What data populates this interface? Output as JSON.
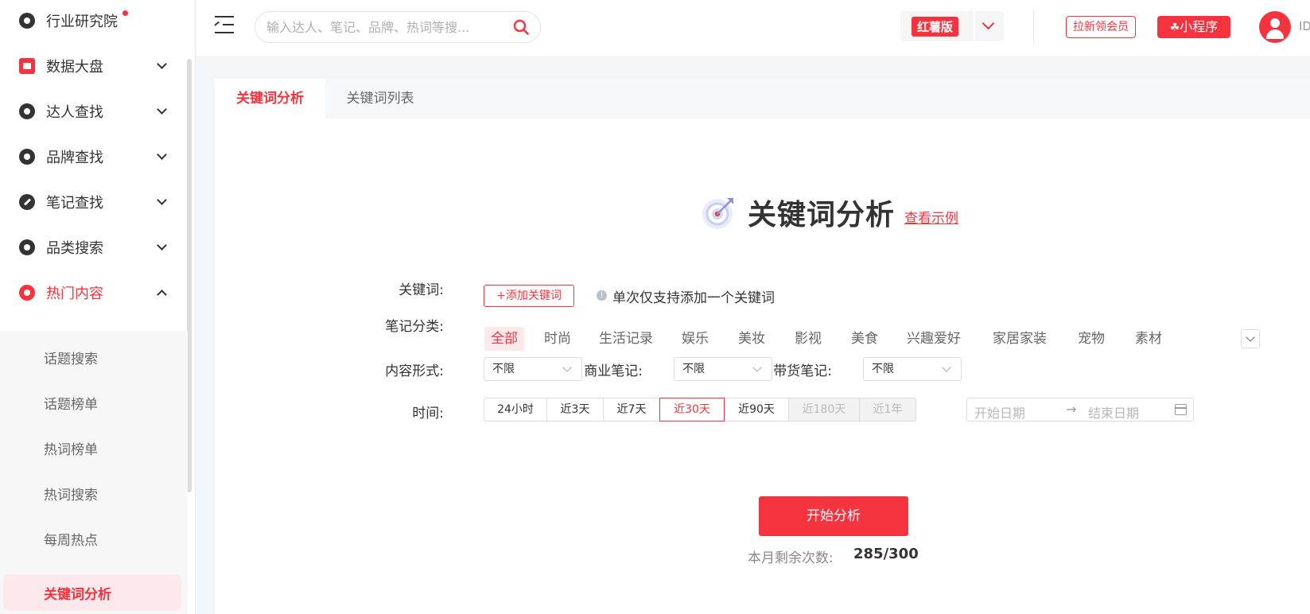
{
  "sidebar": {
    "items": [
      {
        "label": "行业研究院"
      },
      {
        "label": "数据大盘"
      },
      {
        "label": "达人查找"
      },
      {
        "label": "品牌查找"
      },
      {
        "label": "笔记查找"
      },
      {
        "label": "品类搜索"
      },
      {
        "label": "热门内容"
      }
    ],
    "submenu": [
      {
        "label": "话题搜索"
      },
      {
        "label": "话题榜单"
      },
      {
        "label": "热词榜单"
      },
      {
        "label": "热词搜索"
      },
      {
        "label": "每周热点"
      },
      {
        "label": "关键词分析"
      }
    ]
  },
  "header": {
    "search_placeholder": "输入达人、笔记、品牌、热词等搜...",
    "version_badge": "红薯版",
    "invite_label": "拉新领会员",
    "mini_program_label": "小程序",
    "user_id": "ID"
  },
  "tabs": [
    {
      "label": "关键词分析"
    },
    {
      "label": "关键词列表"
    }
  ],
  "hero": {
    "title": "关键词分析",
    "example_link": "查看示例"
  },
  "form": {
    "keyword_label": "关键词:",
    "add_keyword_label": "+添加关键词",
    "hint": "单次仅支持添加一个关键词",
    "category_label": "笔记分类:",
    "categories": [
      "全部",
      "时尚",
      "生活记录",
      "娱乐",
      "美妆",
      "影视",
      "美食",
      "兴趣爱好",
      "家居家装",
      "宠物",
      "素材"
    ],
    "content_form_label": "内容形式:",
    "commercial_label": "商业笔记:",
    "goods_label": "带货笔记:",
    "select_value": "不限",
    "time_label": "时间:",
    "time_options": [
      "24小时",
      "近3天",
      "近7天",
      "近30天",
      "近90天",
      "近180天",
      "近1年"
    ],
    "start_date_placeholder": "开始日期",
    "end_date_placeholder": "结束日期",
    "date_arrow": "→"
  },
  "actions": {
    "start_label": "开始分析",
    "remain_label": "本月剩余次数:",
    "remain_count": "285/300"
  },
  "colors": {
    "accent": "#f5333f",
    "accent_bg": "#fde9eb"
  }
}
